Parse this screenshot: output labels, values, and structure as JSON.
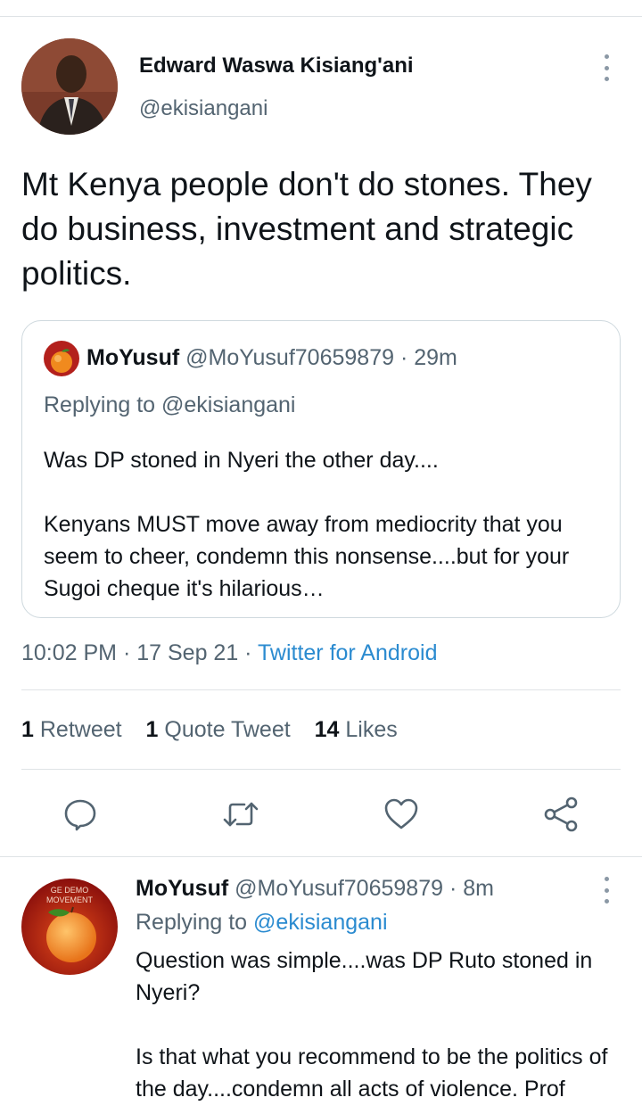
{
  "main_tweet": {
    "author_name": "Edward Waswa Kisiang'ani",
    "author_handle": "@ekisiangani",
    "text": "Mt Kenya people don't do stones. They do business, investment and strategic politics.",
    "timestamp": "10:02 PM",
    "date": "17 Sep 21",
    "separator": " · ",
    "source": "Twitter for Android"
  },
  "quoted_tweet": {
    "author_name": "MoYusuf",
    "author_handle": "@MoYusuf70659879",
    "time_ago": "29m",
    "replying_to": "Replying to @ekisiangani",
    "text": "Was DP stoned in Nyeri the other day....\n\nKenyans MUST move away from mediocrity that you seem to cheer, condemn this nonsense....but for your Sugoi cheque it's hilarious…"
  },
  "stats": {
    "retweets_count": "1",
    "retweets_label": "Retweet",
    "quotes_count": "1",
    "quotes_label": "Quote Tweet",
    "likes_count": "14",
    "likes_label": "Likes"
  },
  "actions": [
    "reply-icon",
    "retweet-icon",
    "like-icon",
    "share-icon"
  ],
  "reply_tweet": {
    "author_name": "MoYusuf",
    "author_handle": "@MoYusuf70659879",
    "time_ago": "8m",
    "replying_prefix": "Replying to ",
    "replying_handle": "@ekisiangani",
    "avatar_text": "GE DEMO\nMOVEMENT",
    "text": "Question was simple....was DP Ruto stoned in Nyeri?\n\n Is that what you recommend to be the politics of the day....condemn all acts of violence. Prof"
  },
  "colors": {
    "accent": "#2b8bd0",
    "text": "#0f1419",
    "secondary": "#536471",
    "border": "#cfd9de"
  }
}
